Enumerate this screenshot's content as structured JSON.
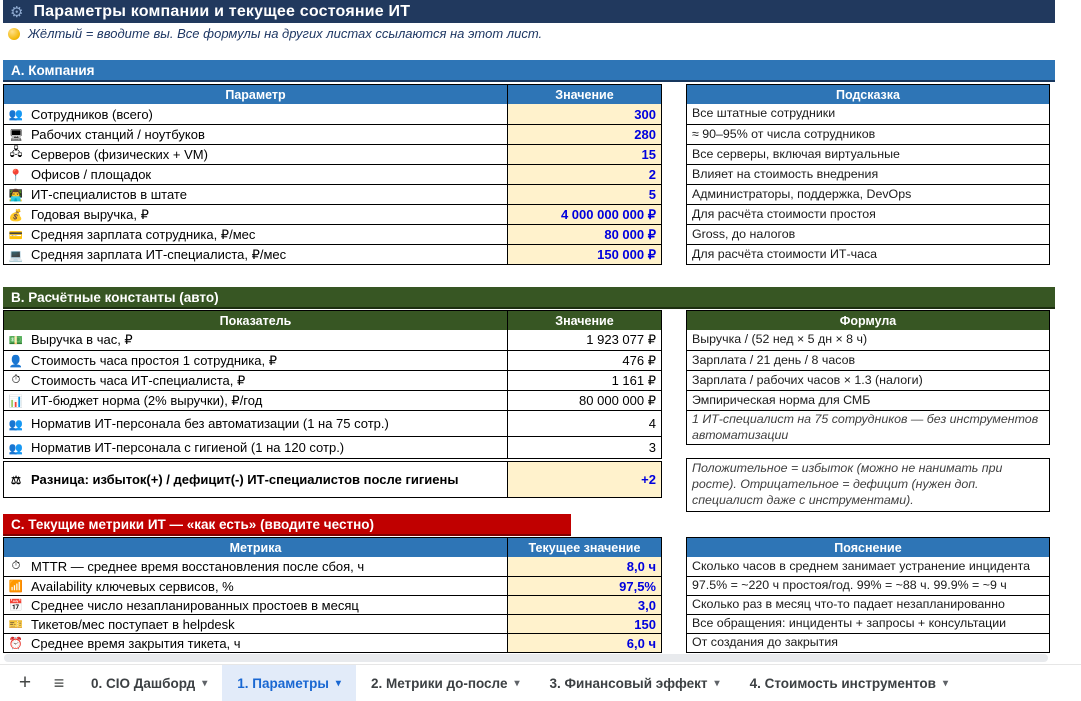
{
  "title_bar": {
    "gear_icon": "⚙",
    "title": "Параметры компании и текущее состояние ИТ"
  },
  "note": {
    "text": "Жёлтый = вводите вы.  Все формулы на других листах ссылаются на этот лист."
  },
  "colors": {
    "accent_blue": "#2E75B6",
    "accent_green": "#375623",
    "accent_red": "#C00000",
    "input_yellow": "#FFF2CC",
    "value_blue": "#0000DD",
    "navy": "#21395E"
  },
  "section_a": {
    "title": "А. Компания",
    "col_param": "Параметр",
    "col_value": "Значение",
    "col_hint": "Подсказка",
    "rows": [
      {
        "icon": "👥",
        "label": "Сотрудников (всего)",
        "value": "300",
        "hint": "Все штатные сотрудники"
      },
      {
        "icon": "🖥",
        "label": "Рабочих станций / ноутбуков",
        "value": "280",
        "hint": "≈ 90–95% от числа сотрудников"
      },
      {
        "icon": "🖧",
        "label": "Серверов (физических + VM)",
        "value": "15",
        "hint": "Все серверы, включая виртуальные"
      },
      {
        "icon": "📍",
        "label": "Офисов / площадок",
        "value": "2",
        "hint": "Влияет на стоимость внедрения"
      },
      {
        "icon": "👨‍💻",
        "label": "ИТ-специалистов в штате",
        "value": "5",
        "hint": "Администраторы, поддержка, DevOps"
      },
      {
        "icon": "💰",
        "label": "Годовая выручка, ₽",
        "value": "4 000 000 000 ₽",
        "hint": "Для расчёта стоимости простоя"
      },
      {
        "icon": "💳",
        "label": "Средняя зарплата сотрудника, ₽/мес",
        "value": "80 000 ₽",
        "hint": "Gross, до налогов"
      },
      {
        "icon": "💻",
        "label": "Средняя зарплата ИТ-специалиста, ₽/мес",
        "value": "150 000 ₽",
        "hint": "Для расчёта стоимости ИТ-часа"
      }
    ]
  },
  "section_b": {
    "title": "B. Расчётные константы (авто)",
    "col_param": "Показатель",
    "col_value": "Значение",
    "col_hint": "Формула",
    "rows": [
      {
        "icon": "💵",
        "label": "Выручка в час, ₽",
        "value": "1 923 077 ₽",
        "hint": "Выручка / (52 нед × 5 дн × 8 ч)"
      },
      {
        "icon": "👤",
        "label": "Стоимость часа простоя 1 сотрудника, ₽",
        "value": "476 ₽",
        "hint": "Зарплата / 21 день / 8 часов"
      },
      {
        "icon": "⏱",
        "label": "Стоимость часа ИТ-специалиста, ₽",
        "value": "1 161 ₽",
        "hint": "Зарплата / рабочих часов × 1.3 (налоги)"
      },
      {
        "icon": "📊",
        "label": "ИТ-бюджет норма (2% выручки), ₽/год",
        "value": "80 000 000 ₽",
        "hint": "Эмпирическая норма для СМБ"
      },
      {
        "icon": "👥",
        "label": "Норматив ИТ-персонала без автоматизации (1 на 75 сотр.)",
        "value": "4",
        "hint": "1 ИТ-специалист на 75 сотрудников — без инструментов автоматизации"
      },
      {
        "icon": "👥",
        "label": "Норматив ИТ-персонала с гигиеной (1 на 120 сотр.)",
        "value": "3",
        "hint": ""
      }
    ],
    "result_row": {
      "icon": "⚖",
      "label": "Разница: избыток(+) / дефицит(-) ИТ-специалистов после гигиены",
      "value": "+2",
      "hint": "Положительное = избыток (можно не нанимать при росте). Отрицательное = дефицит (нужен доп. специалист даже с инструментами)."
    }
  },
  "section_c": {
    "title": "C. Текущие метрики ИТ — «как есть» (вводите честно)",
    "col_param": "Метрика",
    "col_value": "Текущее значение",
    "col_hint": "Пояснение",
    "rows": [
      {
        "icon": "⏱",
        "label": "MTTR — среднее время восстановления после сбоя, ч",
        "value": "8,0 ч",
        "hint": "Сколько часов в среднем занимает устранение инцидента"
      },
      {
        "icon": "📶",
        "label": "Availability ключевых сервисов, %",
        "value": "97,5%",
        "hint": "97.5% = ~220 ч простоя/год. 99% = ~88 ч. 99.9% = ~9 ч"
      },
      {
        "icon": "📅",
        "label": "Среднее число незапланированных простоев в месяц",
        "value": "3,0",
        "hint": "Сколько раз в месяц что-то падает незапланированно"
      },
      {
        "icon": "🎫",
        "label": "Тикетов/мес поступает в helpdesk",
        "value": "150",
        "hint": "Все обращения: инциденты + запросы + консультации"
      },
      {
        "icon": "⏰",
        "label": "Среднее время закрытия тикета, ч",
        "value": "6,0 ч",
        "hint": "От создания до закрытия"
      }
    ]
  },
  "tab_bar": {
    "plus_icon": "+",
    "menu_icon": "≡",
    "dropdown_icon": "▾",
    "tabs": [
      {
        "label": "0. CIO Дашборд"
      },
      {
        "label": "1. Параметры"
      },
      {
        "label": "2. Метрики до-после"
      },
      {
        "label": "3. Финансовый эффект"
      },
      {
        "label": "4. Стоимость инструментов"
      }
    ]
  }
}
